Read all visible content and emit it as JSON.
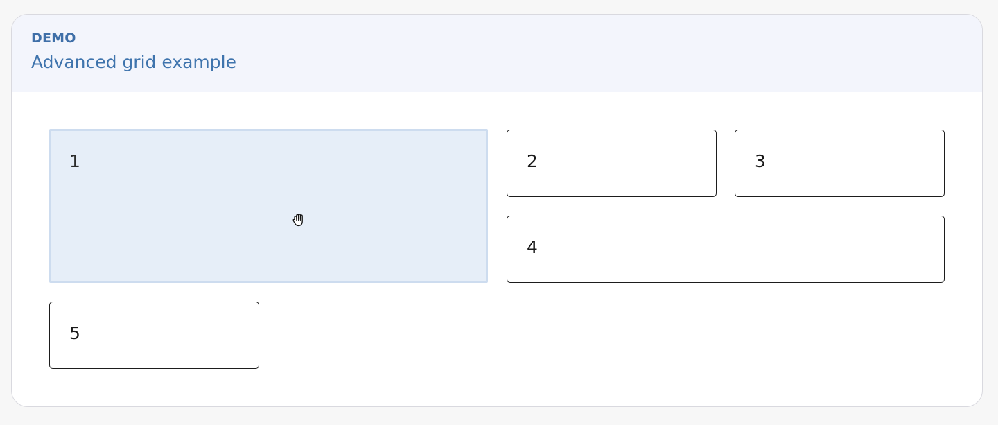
{
  "header": {
    "eyebrow": "DEMO",
    "title": "Advanced grid example"
  },
  "grid": {
    "items": [
      {
        "label": "1",
        "state": "dragging"
      },
      {
        "label": "2"
      },
      {
        "label": "3"
      },
      {
        "label": "4"
      },
      {
        "label": "5"
      }
    ]
  },
  "cursor": {
    "icon": "grab-hand-icon"
  },
  "colors": {
    "accent": "#3f74ad",
    "drag_fill": "#e6eef8",
    "drag_border": "#cddcef"
  }
}
